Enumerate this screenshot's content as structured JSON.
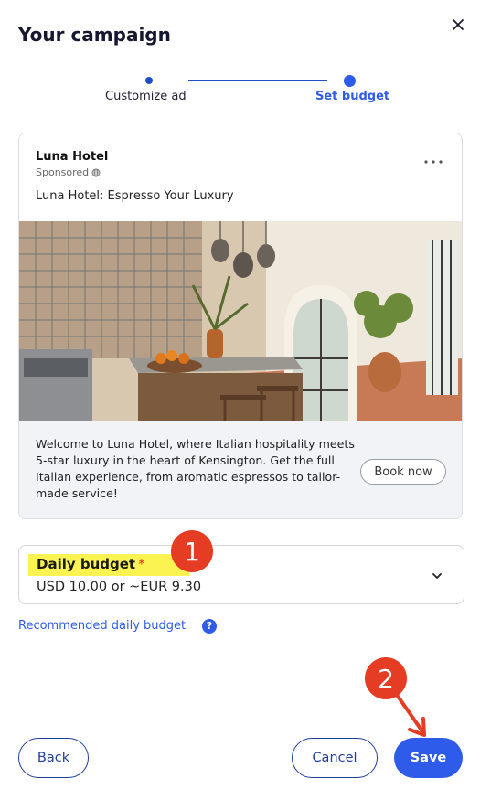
{
  "header": {
    "title": "Your campaign",
    "close_icon": "close-icon"
  },
  "stepper": {
    "steps": [
      {
        "label": "Customize ad",
        "state": "completed"
      },
      {
        "label": "Set budget",
        "state": "active"
      }
    ]
  },
  "ad_preview": {
    "name": "Luna Hotel",
    "sponsored": "Sponsored",
    "headline": "Luna Hotel: Espresso Your Luxury",
    "image_alt": "Italian-style hotel kitchen with tiled wall and arched windows",
    "description": "Welcome to Luna Hotel, where Italian hospitality meets 5-star luxury in the heart of Kensington. Get the full Italian experience, from aromatic espressos to tailor-made service!",
    "cta_label": "Book now",
    "more_icon": "more-options-icon"
  },
  "budget": {
    "label": "Daily budget",
    "required_mark": "*",
    "value": "USD 10.00 or ~EUR 9.30",
    "recommended_link": "Recommended daily budget",
    "help_icon": "?"
  },
  "annotations": {
    "badge_1": "1",
    "badge_2": "2"
  },
  "footer": {
    "back_label": "Back",
    "cancel_label": "Cancel",
    "save_label": "Save"
  },
  "colors": {
    "accent": "#2f5bea",
    "highlight": "#fbf351",
    "annotation": "#e53c24",
    "dark_navy": "#1f3e99"
  }
}
